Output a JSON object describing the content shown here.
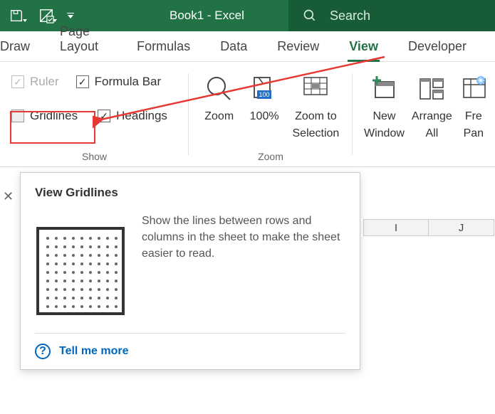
{
  "titlebar": {
    "title": "Book1  -  Excel",
    "search_placeholder": "Search"
  },
  "tabs": {
    "draw": "Draw",
    "page_layout": "Page Layout",
    "formulas": "Formulas",
    "data": "Data",
    "review": "Review",
    "view": "View",
    "developer": "Developer"
  },
  "ribbon": {
    "show": {
      "group_label": "Show",
      "ruler": "Ruler",
      "formula_bar": "Formula Bar",
      "gridlines": "Gridlines",
      "headings": "Headings"
    },
    "zoom": {
      "group_label": "Zoom",
      "zoom": "Zoom",
      "hundred": "100%",
      "zoom_to_selection_l1": "Zoom to",
      "zoom_to_selection_l2": "Selection"
    },
    "window": {
      "new_window_l1": "New",
      "new_window_l2": "Window",
      "arrange_all_l1": "Arrange",
      "arrange_all_l2": "All",
      "freeze_l1": "Fre",
      "freeze_l2": "Pan"
    }
  },
  "columns": {
    "i": "I",
    "j": "J"
  },
  "tooltip": {
    "title": "View Gridlines",
    "desc": "Show the lines between rows and columns in the sheet to make the sheet easier to read.",
    "tell_me_more": "Tell me more"
  }
}
